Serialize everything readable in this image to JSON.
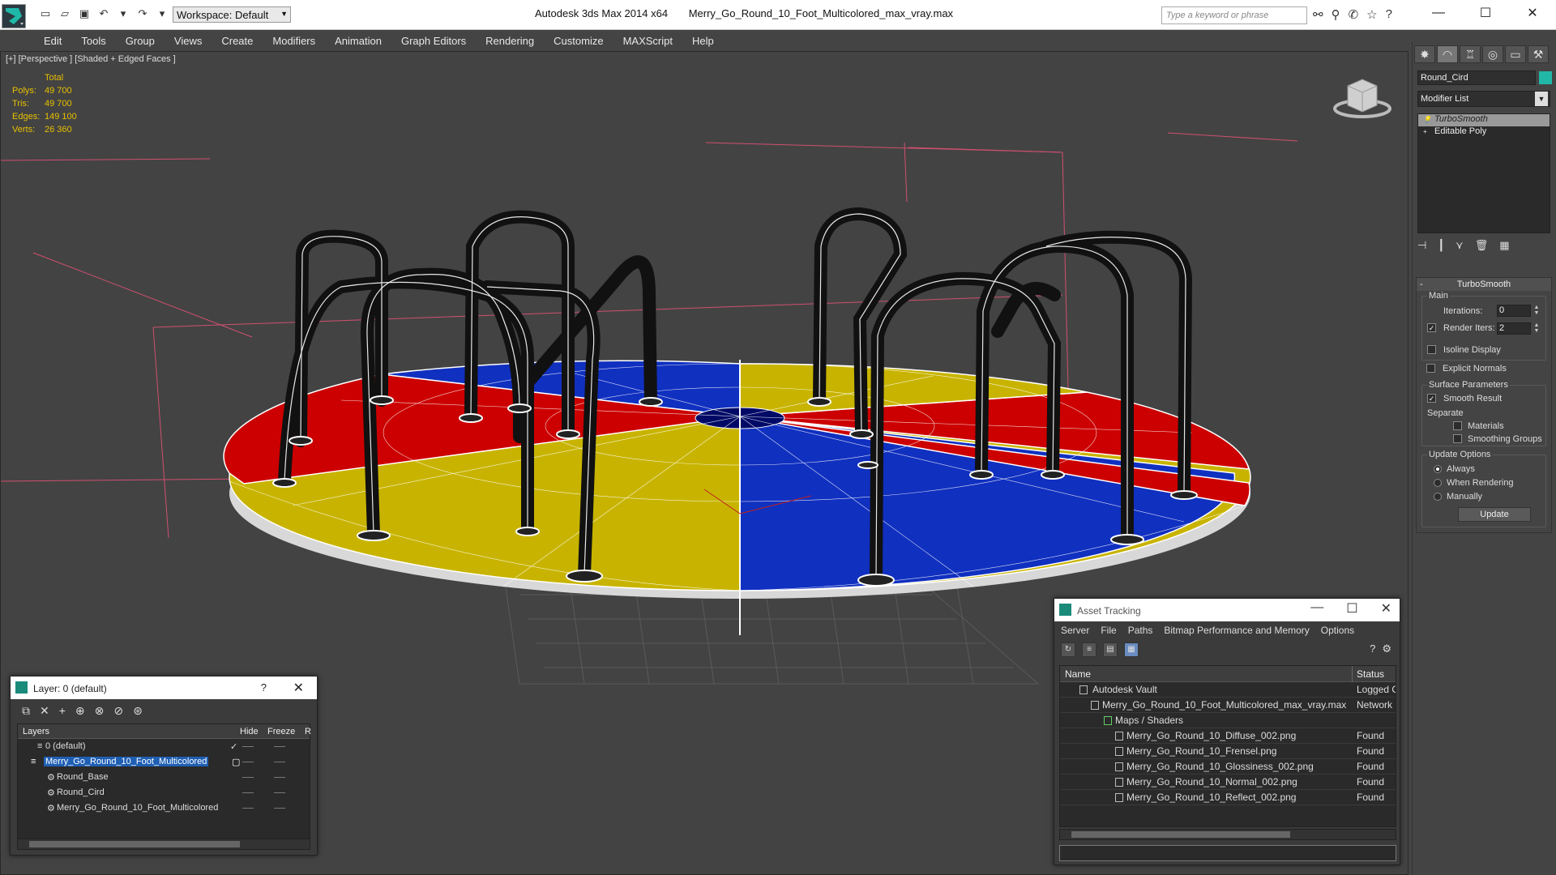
{
  "window": {
    "app_title": "Autodesk 3ds Max  2014 x64",
    "file_title": "Merry_Go_Round_10_Foot_Multicolored_max_vray.max",
    "workspace": "Workspace: Default",
    "search_placeholder": "Type a keyword or phrase",
    "minimize": "—",
    "maximize": "☐",
    "close": "✕"
  },
  "menu": [
    "Edit",
    "Tools",
    "Group",
    "Views",
    "Create",
    "Modifiers",
    "Animation",
    "Graph Editors",
    "Rendering",
    "Customize",
    "MAXScript",
    "Help"
  ],
  "viewport": {
    "label": "[+] [Perspective ] [Shaded + Edged Faces ]",
    "stats": {
      "header": "Total",
      "rows": [
        {
          "label": "Polys:",
          "value": "49 700"
        },
        {
          "label": "Tris:",
          "value": "49 700"
        },
        {
          "label": "Edges:",
          "value": "149 100"
        },
        {
          "label": "Verts:",
          "value": "26 360"
        }
      ]
    },
    "colors": {
      "red": "#cc0000",
      "yellow": "#c8b400",
      "blue": "#1030c0"
    }
  },
  "command_panel": {
    "object_name": "Round_Cird",
    "object_color": "#22b8a8",
    "modifier_list": "Modifier List",
    "stack": [
      "TurboSmooth",
      "Editable Poly"
    ],
    "turbosmooth": {
      "title": "TurboSmooth",
      "main_label": "Main",
      "iterations_label": "Iterations:",
      "iterations_value": "0",
      "render_iters_label": "Render Iters:",
      "render_iters_value": "2",
      "isoline": "Isoline Display",
      "explicit_normals": "Explicit Normals",
      "surface_params": "Surface Parameters",
      "smooth_result": "Smooth Result",
      "separate": "Separate",
      "materials": "Materials",
      "smoothing_groups": "Smoothing Groups",
      "update_options": "Update Options",
      "always": "Always",
      "when_rendering": "When Rendering",
      "manually": "Manually",
      "update_button": "Update"
    }
  },
  "layer_dialog": {
    "title": "Layer: 0 (default)",
    "help": "?",
    "close": "✕",
    "columns": {
      "layers": "Layers",
      "hide": "Hide",
      "freeze": "Freeze",
      "r": "R"
    },
    "rows": [
      {
        "name": "0 (default)",
        "indent": 1
      },
      {
        "name": "Merry_Go_Round_10_Foot_Multicolored",
        "indent": 1
      },
      {
        "name": "Round_Base",
        "indent": 2
      },
      {
        "name": "Round_Cird",
        "indent": 2
      },
      {
        "name": "Merry_Go_Round_10_Foot_Multicolored",
        "indent": 2
      }
    ]
  },
  "asset_dialog": {
    "title": "Asset Tracking",
    "menu": [
      "Server",
      "File",
      "Paths",
      "Bitmap Performance and Memory",
      "Options"
    ],
    "columns": {
      "name": "Name",
      "status": "Status"
    },
    "rows": [
      {
        "name": "Autodesk Vault",
        "status": "Logged O"
      },
      {
        "name": "Merry_Go_Round_10_Foot_Multicolored_max_vray.max",
        "status": "Network F"
      },
      {
        "name": "Maps / Shaders",
        "status": ""
      },
      {
        "name": "Merry_Go_Round_10_Diffuse_002.png",
        "status": "Found"
      },
      {
        "name": "Merry_Go_Round_10_Frensel.png",
        "status": "Found"
      },
      {
        "name": "Merry_Go_Round_10_Glossiness_002.png",
        "status": "Found"
      },
      {
        "name": "Merry_Go_Round_10_Normal_002.png",
        "status": "Found"
      },
      {
        "name": "Merry_Go_Round_10_Reflect_002.png",
        "status": "Found"
      }
    ]
  }
}
